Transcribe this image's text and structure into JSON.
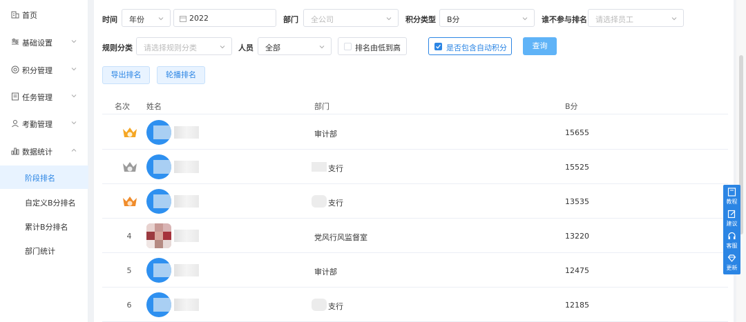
{
  "sidebar": {
    "items": [
      {
        "label": "首页",
        "icon": "building-icon"
      },
      {
        "label": "基础设置",
        "icon": "sliders-icon"
      },
      {
        "label": "积分管理",
        "icon": "points-icon"
      },
      {
        "label": "任务管理",
        "icon": "task-icon"
      },
      {
        "label": "考勤管理",
        "icon": "attendance-icon"
      },
      {
        "label": "数据统计",
        "icon": "chart-icon"
      }
    ],
    "subitems": [
      {
        "label": "阶段排名",
        "active": true
      },
      {
        "label": "自定义B分排名"
      },
      {
        "label": "累计B分排名"
      },
      {
        "label": "部门统计"
      }
    ]
  },
  "filters": {
    "time_label": "时间",
    "time_mode": "年份",
    "year": "2022",
    "dept_label": "部门",
    "dept_placeholder": "全公司",
    "type_label": "积分类型",
    "type_value": "B分",
    "exclude_label": "谁不参与排名",
    "exclude_placeholder": "请选择员工",
    "rule_label": "规则分类",
    "rule_placeholder": "请选择规则分类",
    "person_label": "人员",
    "person_value": "全部",
    "sort_low_label": "排名由低到高",
    "auto_label": "是否包含自动积分",
    "query_label": "查询"
  },
  "actions": {
    "export_label": "导出排名",
    "carousel_label": "轮播排名"
  },
  "table": {
    "headers": {
      "rank": "名次",
      "name": "姓名",
      "dept": "部门",
      "score": "B分"
    },
    "rows": [
      {
        "rank": "1",
        "crown": "gold",
        "dept": "审计部",
        "score": "15655"
      },
      {
        "rank": "2",
        "crown": "silver",
        "dept": "支行",
        "score": "15525"
      },
      {
        "rank": "3",
        "crown": "bronze",
        "dept": "支行",
        "score": "13535"
      },
      {
        "rank": "4",
        "dept": "党风行风监督室",
        "score": "13220"
      },
      {
        "rank": "5",
        "dept": "审计部",
        "score": "12475"
      },
      {
        "rank": "6",
        "dept": "支行",
        "score": "12185"
      }
    ]
  },
  "floatbar": {
    "items": [
      {
        "label": "教程",
        "icon": "book-icon"
      },
      {
        "label": "建议",
        "icon": "edit-icon"
      },
      {
        "label": "客服",
        "icon": "headset-icon"
      },
      {
        "label": "更新",
        "icon": "diamond-icon"
      }
    ]
  },
  "colors": {
    "accent": "#2b85e4",
    "query_button": "#5fb3f7",
    "active_bg": "#e8f3ff",
    "gold": "#f5a623",
    "silver": "#9b9b9b",
    "bronze": "#f08c2a"
  }
}
